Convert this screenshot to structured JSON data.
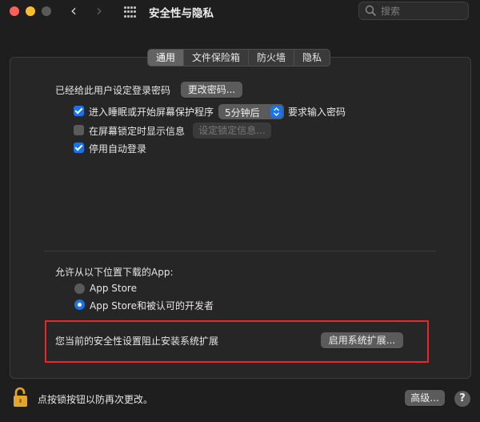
{
  "window": {
    "title": "安全性与隐私"
  },
  "search": {
    "placeholder": "搜索"
  },
  "tabs": [
    {
      "label": "通用",
      "active": true
    },
    {
      "label": "文件保险箱",
      "active": false
    },
    {
      "label": "防火墙",
      "active": false
    },
    {
      "label": "隐私",
      "active": false
    }
  ],
  "general": {
    "password_set_label": "已经给此用户设定登录密码",
    "change_password_button": "更改密码...",
    "require_password": {
      "label": "进入睡眠或开始屏幕保护程序",
      "checked": true,
      "delay_value": "5分钟后",
      "suffix": "要求输入密码"
    },
    "show_message": {
      "label": "在屏幕锁定时显示信息",
      "checked": false,
      "button": "设定锁定信息..."
    },
    "disable_autologin": {
      "label": "停用自动登录",
      "checked": true
    }
  },
  "downloads": {
    "heading": "允许从以下位置下载的App:",
    "options": [
      {
        "label": "App Store",
        "selected": false
      },
      {
        "label": "App Store和被认可的开发者",
        "selected": true
      }
    ]
  },
  "extension": {
    "message": "您当前的安全性设置阻止安装系统扩展",
    "enable_button": "启用系统扩展..."
  },
  "footer": {
    "lock_message": "点按锁按钮以防再次更改。",
    "advanced_button": "高级...",
    "help_label": "?"
  },
  "colors": {
    "accent": "#1a74e8",
    "highlight_border": "#e8262b"
  }
}
